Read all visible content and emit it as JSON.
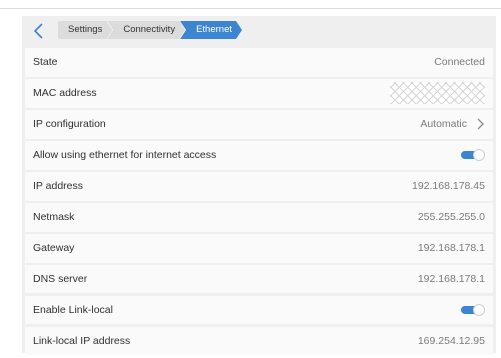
{
  "breadcrumbs": [
    {
      "label": "Settings"
    },
    {
      "label": "Connectivity"
    },
    {
      "label": "Ethernet"
    }
  ],
  "rows": {
    "state": {
      "label": "State",
      "value": "Connected"
    },
    "mac": {
      "label": "MAC address",
      "value_hidden": true
    },
    "ip_config": {
      "label": "IP configuration",
      "value": "Automatic"
    },
    "allow_internet": {
      "label": "Allow using ethernet for internet access",
      "enabled": true
    },
    "ip_address": {
      "label": "IP address",
      "value": "192.168.178.45"
    },
    "netmask": {
      "label": "Netmask",
      "value": "255.255.255.0"
    },
    "gateway": {
      "label": "Gateway",
      "value": "192.168.178.1"
    },
    "dns": {
      "label": "DNS server",
      "value": "192.168.178.1"
    },
    "link_local": {
      "label": "Enable Link-local",
      "enabled": true
    },
    "link_local_ip": {
      "label": "Link-local IP address",
      "value": "169.254.12.95"
    }
  },
  "colors": {
    "accent": "#3c86d1",
    "panel_bg": "#efefef",
    "row_bg": "#fafafa",
    "value_text": "#7a7a7a"
  },
  "icons": {
    "back": "chevron-left-icon",
    "row_arrow": "chevron-right-icon"
  }
}
